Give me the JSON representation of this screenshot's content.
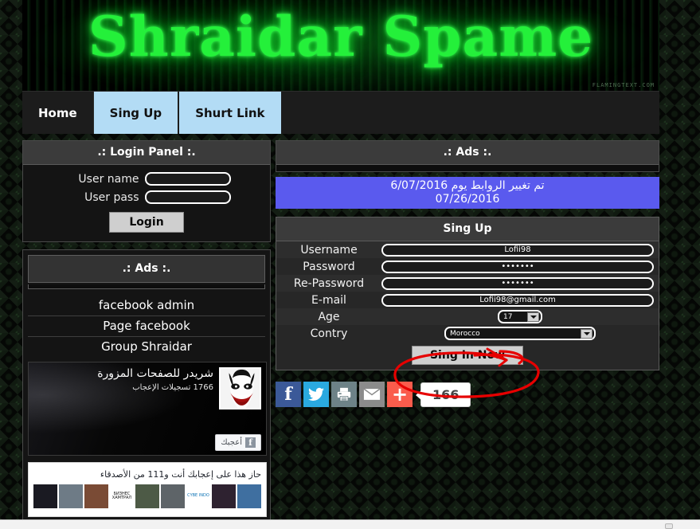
{
  "site": {
    "banner_title": "Shraidar Spame",
    "banner_credit": "FLAMINGTEXT.COM"
  },
  "nav": {
    "items": [
      {
        "label": "Home",
        "style": "dark"
      },
      {
        "label": "Sing Up",
        "style": "blue"
      },
      {
        "label": "Shurt Link",
        "style": "blue"
      }
    ]
  },
  "login_panel": {
    "title": ".: Login Panel :.",
    "username_label": "User name",
    "username_value": "",
    "userpass_label": "User pass",
    "userpass_value": "",
    "login_button": "Login"
  },
  "sidebar_ads": {
    "title": ".: Ads :.",
    "links": [
      "facebook admin",
      "Page facebook",
      "Group Shraidar"
    ]
  },
  "fb_page": {
    "page_name": "شريدر للصفحات المزورة",
    "likes_text": "1766 تسجيلات الإعجاب",
    "like_button": "أعجبك",
    "profile_icon": "joker-face-icon"
  },
  "fb_friends": {
    "caption": "حاز هذا على إعجابك أنت و111 من الأصدقاء",
    "avatars": [
      {
        "label": "",
        "color": "#1a1a22"
      },
      {
        "label": "",
        "color": "#6e7b86"
      },
      {
        "label": "",
        "color": "#7a4b35"
      },
      {
        "label": "БИЗНЕС ХАМТРАЛ",
        "color": "#ffffff",
        "text_color": "#111111"
      },
      {
        "label": "",
        "color": "#4d5a46"
      },
      {
        "label": "",
        "color": "#5e6468"
      },
      {
        "label": "CYBE INDO",
        "color": "#ffffff",
        "text_color": "#0b72b5"
      },
      {
        "label": "",
        "color": "#2e2230"
      },
      {
        "label": "",
        "color": "#3f6fa0"
      }
    ]
  },
  "right_ads": {
    "title": ".: Ads :."
  },
  "marquee": {
    "line1": "تم تغيير الروابط يوم 6/07/2016",
    "line2": "07/26/2016",
    "background": "#5a5aee"
  },
  "signup": {
    "title": "Sing Up",
    "fields": [
      {
        "label": "Username",
        "type": "text",
        "value": "Lofii98"
      },
      {
        "label": "Password",
        "type": "password",
        "value": "•••••••"
      },
      {
        "label": "Re-Password",
        "type": "password",
        "value": "•••••••"
      },
      {
        "label": "E-mail",
        "type": "text",
        "value": "Lofii98@gmail.com"
      },
      {
        "label": "Age",
        "type": "select",
        "value": "17"
      },
      {
        "label": "Contry",
        "type": "select",
        "value": "Morocco"
      }
    ],
    "submit_button": "Sing In Now"
  },
  "share": {
    "buttons": [
      {
        "name": "facebook",
        "glyph": "f",
        "color": "#3b5998"
      },
      {
        "name": "twitter",
        "glyph": "",
        "color": "#2aa9e0"
      },
      {
        "name": "print",
        "glyph": "",
        "color": "#6d8287"
      },
      {
        "name": "email",
        "glyph": "",
        "color": "#8b8b8b"
      },
      {
        "name": "addthis",
        "glyph": "+",
        "color": "#fa5c4c"
      }
    ],
    "count": "166"
  },
  "annotation": {
    "shape": "red-ellipse-with-arrow",
    "color": "#e60000",
    "target": "Sing In Now"
  }
}
